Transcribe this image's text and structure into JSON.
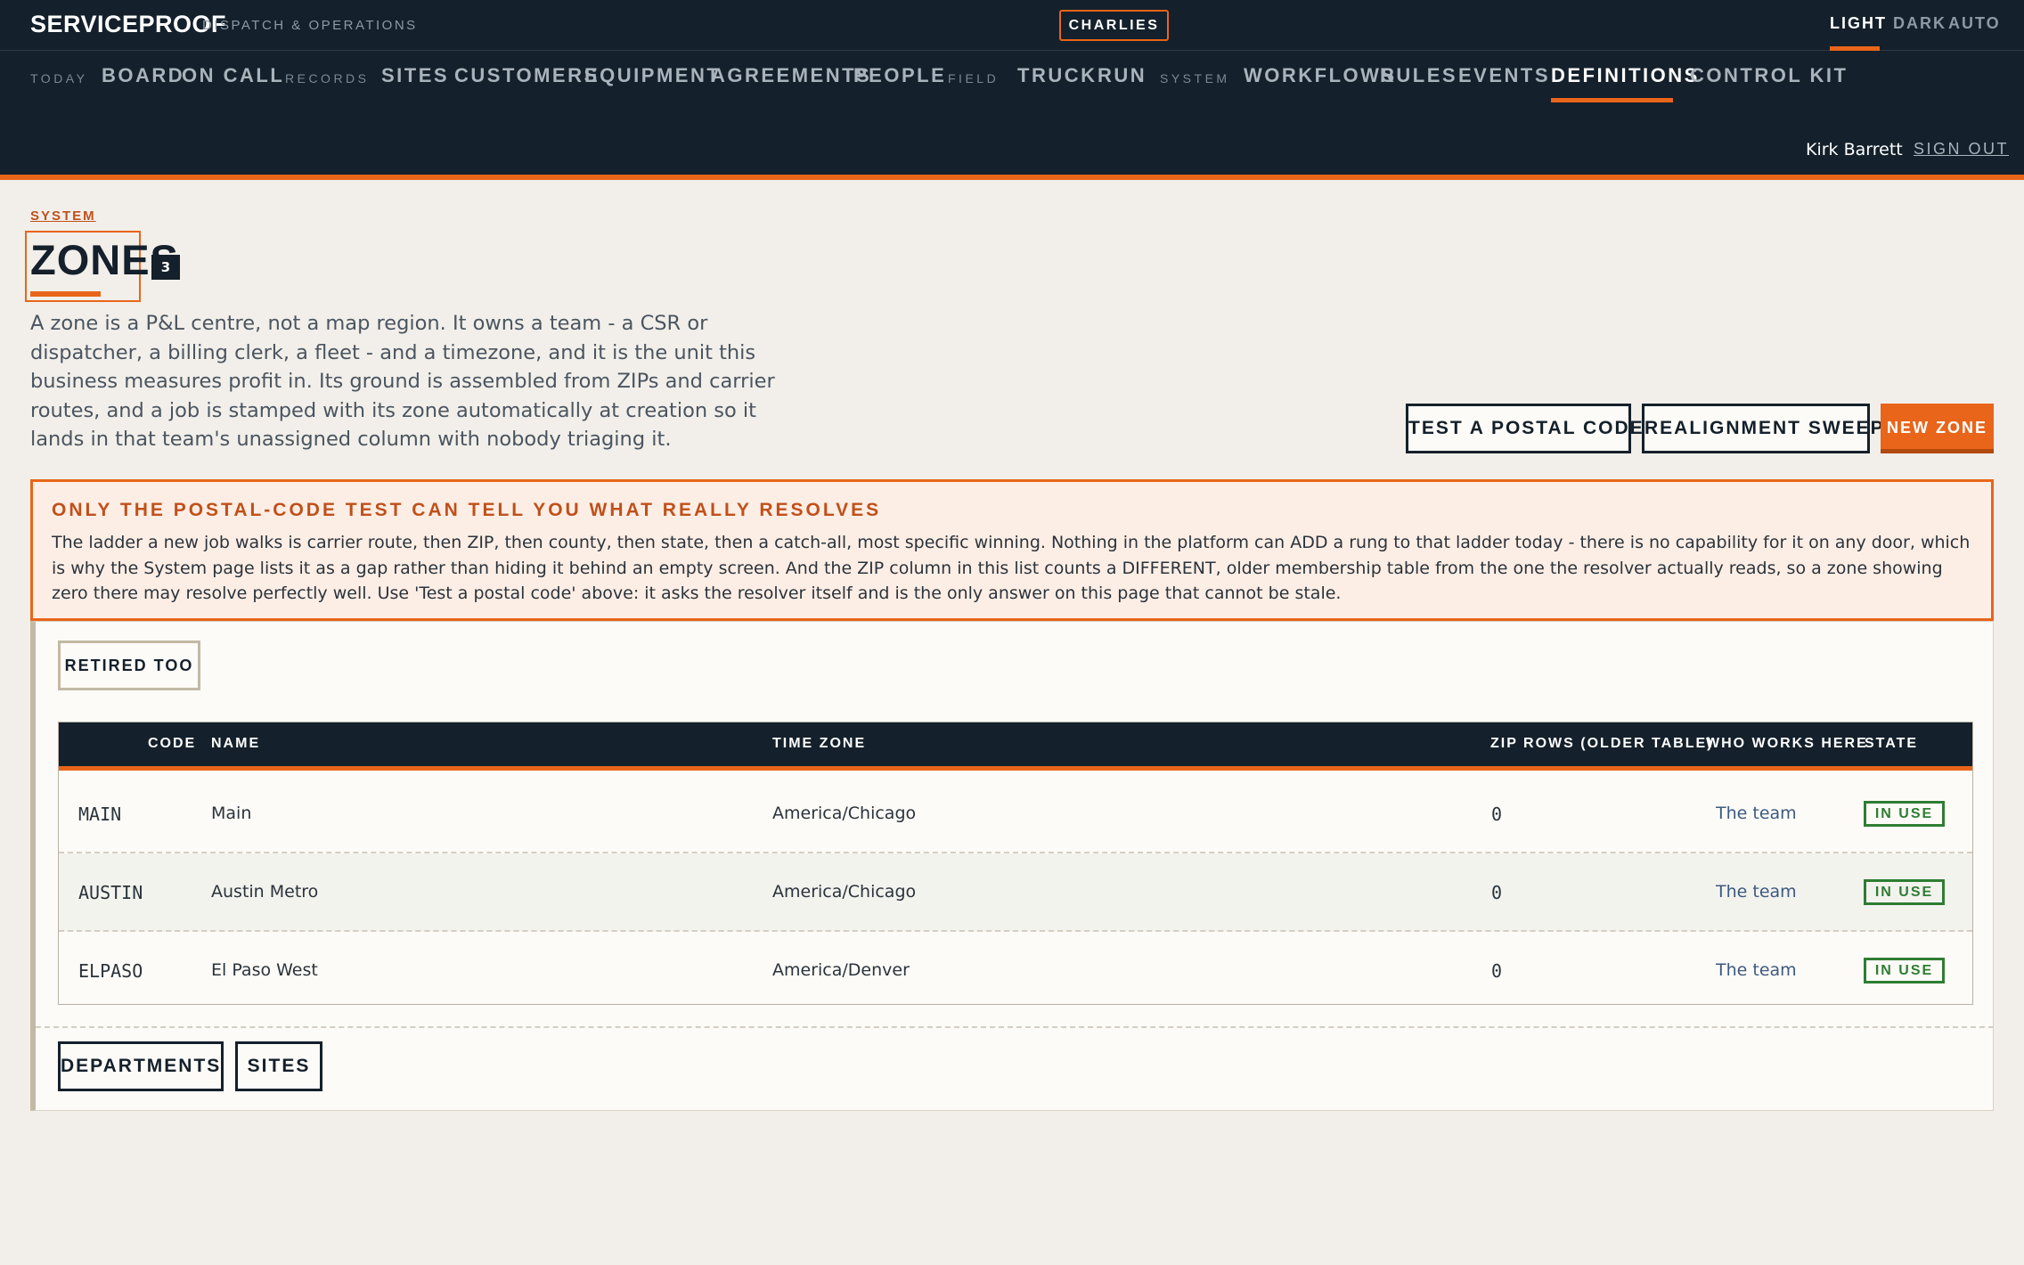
{
  "app": {
    "brand": "SERVICEPROOF",
    "brand_sub": "DISPATCH & OPERATIONS",
    "org": "CHARLIES",
    "themes": [
      "LIGHT",
      "DARK",
      "AUTO"
    ],
    "active_theme": "LIGHT"
  },
  "nav": {
    "groups": {
      "today": "TODAY",
      "records": "RECORDS",
      "field": "FIELD",
      "system": "SYSTEM"
    },
    "items": {
      "board": "BOARD",
      "on_call": "ON CALL",
      "sites": "SITES",
      "customers": "CUSTOMERS",
      "equipment": "EQUIPMENT",
      "agreements": "AGREEMENTS",
      "people": "PEOPLE",
      "truck": "TRUCK",
      "run": "RUN",
      "workflows": "WORKFLOWS",
      "rules": "RULES",
      "events": "EVENTS",
      "definitions": "DEFINITIONS",
      "control_kit": "CONTROL KIT"
    },
    "active": "DEFINITIONS"
  },
  "user": {
    "name": "Kirk Barrett",
    "sign_out": "SIGN OUT"
  },
  "page": {
    "breadcrumb": "SYSTEM",
    "title": "ZONES",
    "count": "3",
    "intro": "A zone is a P&L centre, not a map region. It owns a team - a CSR or dispatcher, a billing clerk, a fleet - and a timezone, and it is the unit this business measures profit in. Its ground is assembled from ZIPs and carrier routes, and a job is stamped with its zone automatically at creation so it lands in that team's unassigned column with nobody triaging it.",
    "actions": {
      "test": "TEST A POSTAL CODE",
      "sweep": "REALIGNMENT SWEEP",
      "new": "NEW ZONE"
    }
  },
  "callout": {
    "title": "ONLY THE POSTAL-CODE TEST CAN TELL YOU WHAT REALLY RESOLVES",
    "body": "The ladder a new job walks is carrier route, then ZIP, then county, then state, then a catch-all, most specific winning. Nothing in the platform can ADD a rung to that ladder today - there is no capability for it on any door, which is why the System page lists it as a gap rather than hiding it behind an empty screen. And the ZIP column in this list counts a DIFFERENT, older membership table from the one the resolver actually reads, so a zone showing zero there may resolve perfectly well. Use 'Test a postal code' above: it asks the resolver itself and is the only answer on this page that cannot be stale."
  },
  "filter": {
    "retired": "RETIRED TOO"
  },
  "table": {
    "headers": {
      "code": "CODE",
      "name": "NAME",
      "tz": "TIME ZONE",
      "zip": "ZIP ROWS (OLDER TABLE)",
      "who": "WHO WORKS HERE",
      "state": "STATE"
    },
    "rows": [
      {
        "code": "MAIN",
        "name": "Main",
        "tz": "America/Chicago",
        "zip": "0",
        "who": "The team",
        "state": "IN USE"
      },
      {
        "code": "AUSTIN",
        "name": "Austin Metro",
        "tz": "America/Chicago",
        "zip": "0",
        "who": "The team",
        "state": "IN USE"
      },
      {
        "code": "ELPASO",
        "name": "El Paso West",
        "tz": "America/Denver",
        "zip": "0",
        "who": "The team",
        "state": "IN USE"
      }
    ]
  },
  "footer": {
    "departments": "DEPARTMENTS",
    "sites": "SITES"
  },
  "colors": {
    "accent": "#e8651a",
    "header_bg": "#14202b",
    "page_bg": "#f2efea",
    "in_use": "#2e7d32"
  }
}
